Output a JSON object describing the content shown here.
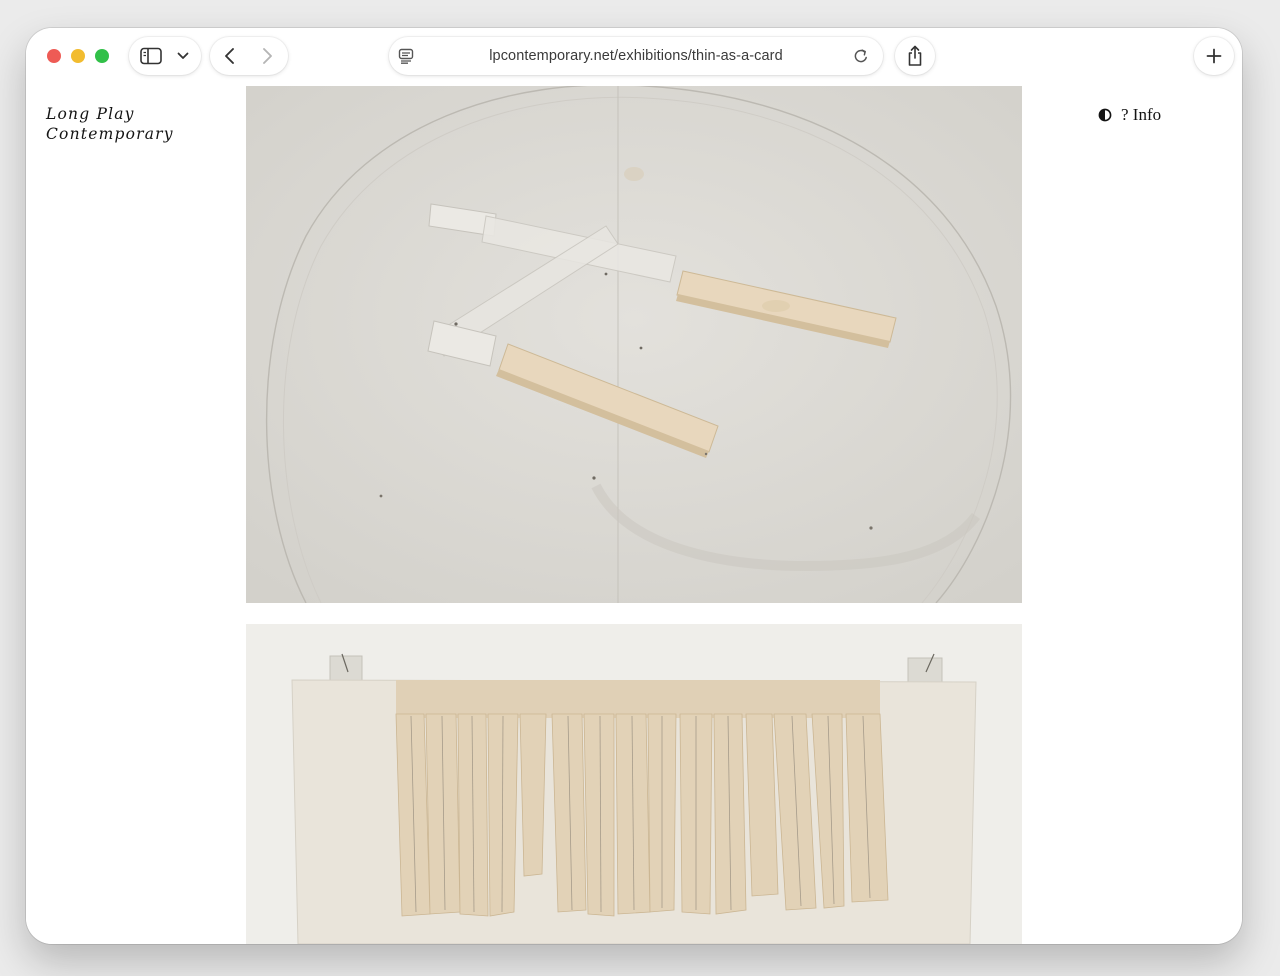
{
  "browser": {
    "url": "lpcontemporary.net/exhibitions/thin-as-a-card",
    "icons": {
      "sidebar": "sidebar-icon",
      "chevron": "chevron-down-icon",
      "back": "back-arrow-icon",
      "forward": "forward-arrow-icon",
      "page": "page-menu-icon",
      "reload": "reload-icon",
      "share": "share-icon",
      "new_tab": "plus-icon"
    }
  },
  "site": {
    "title_line1": "Long Play",
    "title_line2": "Contemporary",
    "info_label": "? Info"
  },
  "colors": {
    "paper": "#dcdad5",
    "felt": "#e6d6bc",
    "wall": "#efeeea"
  }
}
